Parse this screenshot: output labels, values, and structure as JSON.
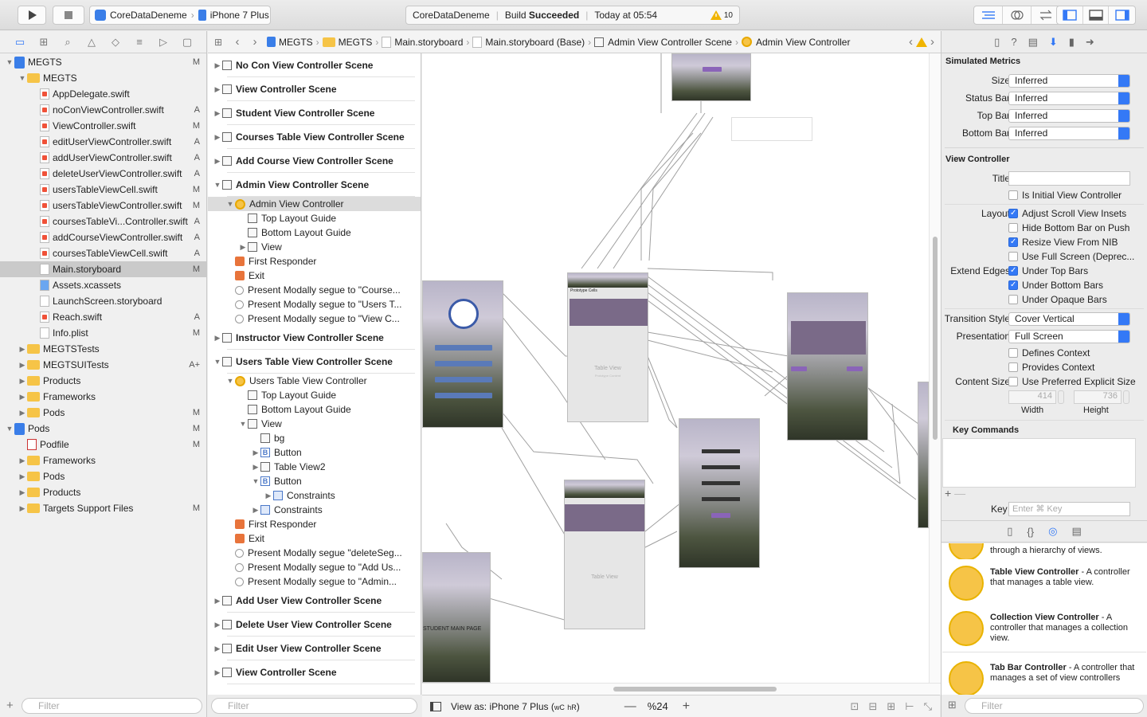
{
  "toolbar": {
    "scheme": "CoreDataDeneme",
    "device": "iPhone 7 Plus",
    "activity_project": "CoreDataDeneme",
    "activity_status_prefix": "Build",
    "activity_status": "Succeeded",
    "activity_time": "Today at 05:54",
    "warning_count": "10"
  },
  "navigator": {
    "items": [
      {
        "label": "MEGTS",
        "status": "M",
        "indent": 0,
        "icon": "project",
        "tri": "▼"
      },
      {
        "label": "MEGTS",
        "status": "",
        "indent": 1,
        "icon": "folder",
        "tri": "▼"
      },
      {
        "label": "AppDelegate.swift",
        "status": "",
        "indent": 2,
        "icon": "swift"
      },
      {
        "label": "noConViewController.swift",
        "status": "A",
        "indent": 2,
        "icon": "swift"
      },
      {
        "label": "ViewController.swift",
        "status": "M",
        "indent": 2,
        "icon": "swift"
      },
      {
        "label": "editUserViewController.swift",
        "status": "A",
        "indent": 2,
        "icon": "swift"
      },
      {
        "label": "addUserViewController.swift",
        "status": "A",
        "indent": 2,
        "icon": "swift"
      },
      {
        "label": "deleteUserViewController.swift",
        "status": "A",
        "indent": 2,
        "icon": "swift"
      },
      {
        "label": "usersTableViewCell.swift",
        "status": "M",
        "indent": 2,
        "icon": "swift"
      },
      {
        "label": "usersTableViewController.swift",
        "status": "M",
        "indent": 2,
        "icon": "swift"
      },
      {
        "label": "coursesTableVi...Controller.swift",
        "status": "A",
        "indent": 2,
        "icon": "swift"
      },
      {
        "label": "addCourseViewController.swift",
        "status": "A",
        "indent": 2,
        "icon": "swift"
      },
      {
        "label": "coursesTableViewCell.swift",
        "status": "A",
        "indent": 2,
        "icon": "swift"
      },
      {
        "label": "Main.storyboard",
        "status": "M",
        "indent": 2,
        "icon": "storyboard",
        "selected": true
      },
      {
        "label": "Assets.xcassets",
        "status": "",
        "indent": 2,
        "icon": "assets"
      },
      {
        "label": "LaunchScreen.storyboard",
        "status": "",
        "indent": 2,
        "icon": "storyboard"
      },
      {
        "label": "Reach.swift",
        "status": "A",
        "indent": 2,
        "icon": "swift"
      },
      {
        "label": "Info.plist",
        "status": "M",
        "indent": 2,
        "icon": "plist"
      },
      {
        "label": "MEGTSTests",
        "status": "",
        "indent": 1,
        "icon": "folder",
        "tri": "▶"
      },
      {
        "label": "MEGTSUITests",
        "status": "A+",
        "indent": 1,
        "icon": "folder",
        "tri": "▶"
      },
      {
        "label": "Products",
        "status": "",
        "indent": 1,
        "icon": "folder",
        "tri": "▶"
      },
      {
        "label": "Frameworks",
        "status": "",
        "indent": 1,
        "icon": "folder",
        "tri": "▶"
      },
      {
        "label": "Pods",
        "status": "M",
        "indent": 1,
        "icon": "folder",
        "tri": "▶"
      },
      {
        "label": "Pods",
        "status": "M",
        "indent": 0,
        "icon": "project",
        "tri": "▼"
      },
      {
        "label": "Podfile",
        "status": "M",
        "indent": 1,
        "icon": "rb"
      },
      {
        "label": "Frameworks",
        "status": "",
        "indent": 1,
        "icon": "folder",
        "tri": "▶"
      },
      {
        "label": "Pods",
        "status": "",
        "indent": 1,
        "icon": "folder",
        "tri": "▶"
      },
      {
        "label": "Products",
        "status": "",
        "indent": 1,
        "icon": "folder",
        "tri": "▶"
      },
      {
        "label": "Targets Support Files",
        "status": "M",
        "indent": 1,
        "icon": "folder",
        "tri": "▶"
      }
    ],
    "filter_placeholder": "Filter"
  },
  "jumpbar": {
    "crumbs": [
      "MEGTS",
      "MEGTS",
      "Main.storyboard",
      "Main.storyboard (Base)",
      "Admin View Controller Scene",
      "Admin View Controller"
    ]
  },
  "outline": {
    "rows": [
      {
        "label": "No Con View Controller Scene",
        "type": "scene",
        "tri": "▶"
      },
      {
        "label": "View Controller Scene",
        "type": "scene",
        "tri": "▶"
      },
      {
        "label": "Student View Controller Scene",
        "type": "scene",
        "tri": "▶"
      },
      {
        "label": "Courses Table View Controller Scene",
        "type": "scene",
        "tri": "▶"
      },
      {
        "label": "Add Course View Controller Scene",
        "type": "scene",
        "tri": "▶"
      },
      {
        "label": "Admin View Controller Scene",
        "type": "scene",
        "tri": "▼"
      },
      {
        "label": "Admin View Controller",
        "type": "vc",
        "indent": 1,
        "tri": "▼",
        "selected": true
      },
      {
        "label": "Top Layout Guide",
        "type": "sq",
        "indent": 2
      },
      {
        "label": "Bottom Layout Guide",
        "type": "sq",
        "indent": 2
      },
      {
        "label": "View",
        "type": "sq",
        "indent": 2,
        "tri": "▶"
      },
      {
        "label": "First Responder",
        "type": "cube",
        "indent": 1
      },
      {
        "label": "Exit",
        "type": "exit",
        "indent": 1
      },
      {
        "label": "Present Modally segue to \"Course...",
        "type": "segue",
        "indent": 1
      },
      {
        "label": "Present Modally segue to \"Users T...",
        "type": "segue",
        "indent": 1
      },
      {
        "label": "Present Modally segue to \"View C...",
        "type": "segue",
        "indent": 1
      },
      {
        "label": "Instructor View Controller Scene",
        "type": "scene",
        "tri": "▶"
      },
      {
        "label": "Users Table View Controller Scene",
        "type": "scene",
        "tri": "▼"
      },
      {
        "label": "Users Table View Controller",
        "type": "vc",
        "indent": 1,
        "tri": "▼"
      },
      {
        "label": "Top Layout Guide",
        "type": "sq",
        "indent": 2
      },
      {
        "label": "Bottom Layout Guide",
        "type": "sq",
        "indent": 2
      },
      {
        "label": "View",
        "type": "sq",
        "indent": 2,
        "tri": "▼"
      },
      {
        "label": "bg",
        "type": "sq",
        "indent": 3
      },
      {
        "label": "Button",
        "type": "b",
        "indent": 3,
        "tri": "▶"
      },
      {
        "label": "Table View2",
        "type": "sq",
        "indent": 3,
        "tri": "▶"
      },
      {
        "label": "Button",
        "type": "b",
        "indent": 3,
        "tri": "▼"
      },
      {
        "label": "Constraints",
        "type": "c",
        "indent": 4,
        "tri": "▶"
      },
      {
        "label": "Constraints",
        "type": "c",
        "indent": 3,
        "tri": "▶"
      },
      {
        "label": "First Responder",
        "type": "cube",
        "indent": 1
      },
      {
        "label": "Exit",
        "type": "exit",
        "indent": 1
      },
      {
        "label": "Present Modally segue \"deleteSeg...",
        "type": "segue",
        "indent": 1
      },
      {
        "label": "Present Modally segue to \"Add Us...",
        "type": "segue",
        "indent": 1
      },
      {
        "label": "Present Modally segue to \"Admin...",
        "type": "segue",
        "indent": 1
      },
      {
        "label": "Add User View Controller Scene",
        "type": "scene",
        "tri": "▶"
      },
      {
        "label": "Delete User View Controller Scene",
        "type": "scene",
        "tri": "▶"
      },
      {
        "label": "Edit User View Controller Scene",
        "type": "scene",
        "tri": "▶"
      },
      {
        "label": "View Controller Scene",
        "type": "scene",
        "tri": "▶"
      }
    ],
    "filter_placeholder": "Filter"
  },
  "canvas": {
    "student_main_label": "STUDENT MAIN PAGE",
    "table_view_label": "Table View",
    "prototype_content": "Prototype Content",
    "prototype_cells": "Prototype Cells"
  },
  "canvas_bar": {
    "view_as": "View as: iPhone 7 Plus (",
    "wc": "wC",
    "hr": "hR",
    "zoom": "%24"
  },
  "inspector": {
    "simulated_metrics": "Simulated Metrics",
    "metrics": [
      {
        "label": "Size",
        "value": "Inferred"
      },
      {
        "label": "Status Bar",
        "value": "Inferred"
      },
      {
        "label": "Top Bar",
        "value": "Inferred"
      },
      {
        "label": "Bottom Bar",
        "value": "Inferred"
      }
    ],
    "view_controller": "View Controller",
    "title_label": "Title",
    "is_initial": "Is Initial View Controller",
    "layout_label": "Layout",
    "adjust_scroll": "Adjust Scroll View Insets",
    "hide_bottom": "Hide Bottom Bar on Push",
    "resize_nib": "Resize View From NIB",
    "full_screen": "Use Full Screen (Deprec...",
    "extend_edges_label": "Extend Edges",
    "under_top": "Under Top Bars",
    "under_bottom": "Under Bottom Bars",
    "under_opaque": "Under Opaque Bars",
    "transition_label": "Transition Style",
    "transition_value": "Cover Vertical",
    "presentation_label": "Presentation",
    "presentation_value": "Full Screen",
    "defines_context": "Defines Context",
    "provides_context": "Provides Context",
    "content_size_label": "Content Size",
    "preferred_size": "Use Preferred Explicit Size",
    "width_value": "414",
    "height_value": "736",
    "width_label": "Width",
    "height_label": "Height",
    "key_commands": "Key Commands",
    "key_label": "Key",
    "key_placeholder": "Enter ⌘ Key",
    "library": [
      {
        "title": "",
        "desc": "through a hierarchy of views."
      },
      {
        "title": "Table View Controller",
        "desc": " - A controller that manages a table view."
      },
      {
        "title": "Collection View Controller",
        "desc": " - A controller that manages a collection view."
      },
      {
        "title": "Tab Bar Controller",
        "desc": " - A controller that manages a set of view controllers"
      }
    ],
    "filter_placeholder": "Filter"
  }
}
